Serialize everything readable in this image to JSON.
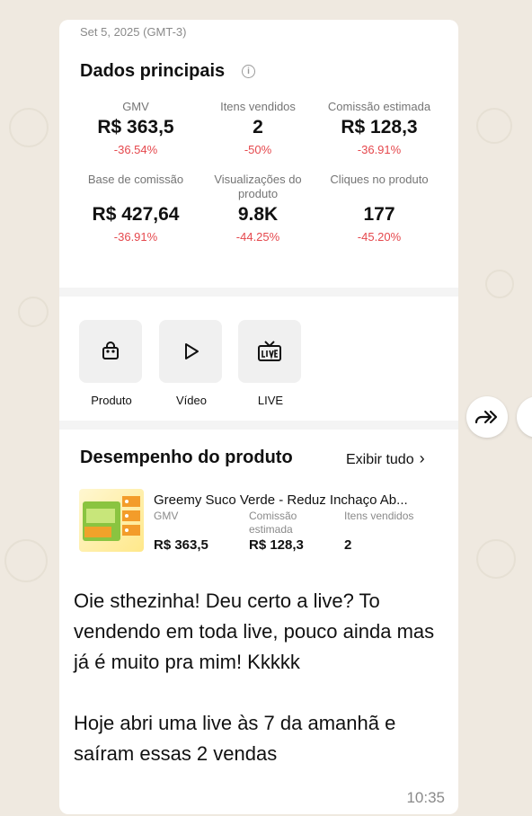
{
  "header": {
    "date": "Set 5, 2025 (GMT-3)"
  },
  "main_data": {
    "title": "Dados principais",
    "info_icon": "i",
    "metrics": [
      {
        "label": "GMV",
        "value": "R$ 363,5",
        "change": "-36.54%"
      },
      {
        "label": "Itens vendidos",
        "value": "2",
        "change": "-50%"
      },
      {
        "label": "Comissão estimada",
        "value": "R$ 128,3",
        "change": "-36.91%"
      },
      {
        "label": "Base de comissão",
        "value": "R$ 427,64",
        "change": "-36.91%"
      },
      {
        "label": "Visualizações do produto",
        "value": "9.8K",
        "change": "-44.25%"
      },
      {
        "label": "Cliques no produto",
        "value": "177",
        "change": "-45.20%"
      }
    ]
  },
  "tools": [
    {
      "label": "Produto",
      "icon": "shopping-bag-icon"
    },
    {
      "label": "Vídeo",
      "icon": "play-icon"
    },
    {
      "label": "LIVE",
      "icon": "live-tv-icon"
    }
  ],
  "performance": {
    "title": "Desempenho do produto",
    "view_all": "Exibir tudo",
    "product": {
      "name": "Greemy Suco Verde - Reduz Inchaço Ab...",
      "gmv_label": "GMV",
      "gmv_value": "R$ 363,5",
      "commission_label": "Comissão estimada",
      "commission_value": "R$ 128,3",
      "items_label": "Itens vendidos",
      "items_value": "2"
    }
  },
  "message": {
    "text": "Oie sthezinha! Deu certo a live? To vendendo em toda live, pouco ainda mas já é muito pra mim! Kkkkk\n\nHoje abri uma live às 7 da amanhã e saíram essas 2 vendas",
    "time": "10:35"
  },
  "colors": {
    "negative": "#e5484d",
    "background": "#efe9e0",
    "bubble": "#ffffff"
  }
}
